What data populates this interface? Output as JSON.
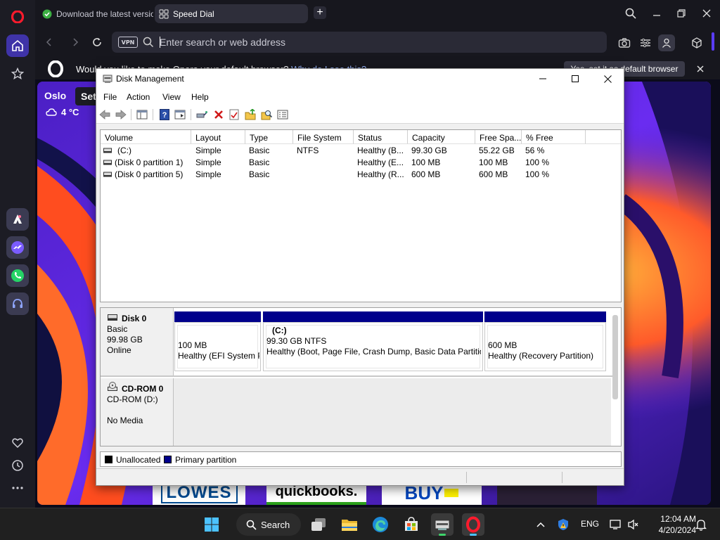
{
  "browser": {
    "tabs": [
      {
        "label": "Download the latest versio"
      },
      {
        "label": "Speed Dial"
      }
    ],
    "address": {
      "vpn_label": "VPN",
      "placeholder": "Enter search or web address"
    },
    "notification": {
      "text": "Would you like to make Opera your default browser?",
      "link": "Why do I see this?",
      "button": "Yes, set it as default browser"
    },
    "speed_dial": {
      "weather_city": "Oslo",
      "weather_temp": "4 °C",
      "settings_chip": "Settings",
      "tiles": [
        "LOWES",
        "quickbooks.",
        "BUY"
      ]
    }
  },
  "disk_management": {
    "title": "Disk Management",
    "menu": [
      "File",
      "Action",
      "View",
      "Help"
    ],
    "columns": [
      "Volume",
      "Layout",
      "Type",
      "File System",
      "Status",
      "Capacity",
      "Free Spa...",
      "% Free"
    ],
    "volumes": [
      {
        "volume": "(C:)",
        "layout": "Simple",
        "type": "Basic",
        "fs": "NTFS",
        "status": "Healthy (B...",
        "capacity": "99.30 GB",
        "free": "55.22 GB",
        "pct": "56 %"
      },
      {
        "volume": "(Disk 0 partition 1)",
        "layout": "Simple",
        "type": "Basic",
        "fs": "",
        "status": "Healthy (E...",
        "capacity": "100 MB",
        "free": "100 MB",
        "pct": "100 %"
      },
      {
        "volume": "(Disk 0 partition 5)",
        "layout": "Simple",
        "type": "Basic",
        "fs": "",
        "status": "Healthy (R...",
        "capacity": "600 MB",
        "free": "600 MB",
        "pct": "100 %"
      }
    ],
    "disks": [
      {
        "name": "Disk 0",
        "lines": [
          "Basic",
          "99.98 GB",
          "Online"
        ],
        "partitions": [
          {
            "title": "",
            "size": "100 MB",
            "status": "Healthy (EFI System Partition)"
          },
          {
            "title": "(C:)",
            "size": "99.30 GB NTFS",
            "status": "Healthy (Boot, Page File, Crash Dump, Basic Data Partition)"
          },
          {
            "title": "",
            "size": "600 MB",
            "status": "Healthy (Recovery Partition)"
          }
        ]
      },
      {
        "name": "CD-ROM 0",
        "lines": [
          "CD-ROM (D:)",
          "",
          "No Media"
        ]
      }
    ],
    "legend": [
      {
        "label": "Unallocated",
        "color": "#000000"
      },
      {
        "label": "Primary partition",
        "color": "#00008b"
      }
    ]
  },
  "taskbar": {
    "search_label": "Search",
    "language": "ENG",
    "time": "12:04 AM",
    "date": "4/20/2024"
  },
  "colors": {
    "opera_red": "#ff1b2d",
    "opera_accent": "#3f33a8",
    "primary_partition": "#00008b"
  }
}
